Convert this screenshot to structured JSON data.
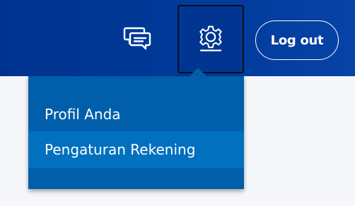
{
  "header": {
    "logout_label": "Log out",
    "icons": {
      "messages": "chat-bubbles-icon",
      "settings": "gear-icon"
    }
  },
  "settings_menu": {
    "items": [
      {
        "label": "Profil Anda"
      },
      {
        "label": "Pengaturan Rekening",
        "highlighted": true
      }
    ]
  },
  "colors": {
    "header_bg": "#003a9a",
    "menu_bg": "#005eaa",
    "menu_highlight": "#0070bf",
    "text": "#ffffff",
    "page_bg": "#f5f7fa"
  }
}
